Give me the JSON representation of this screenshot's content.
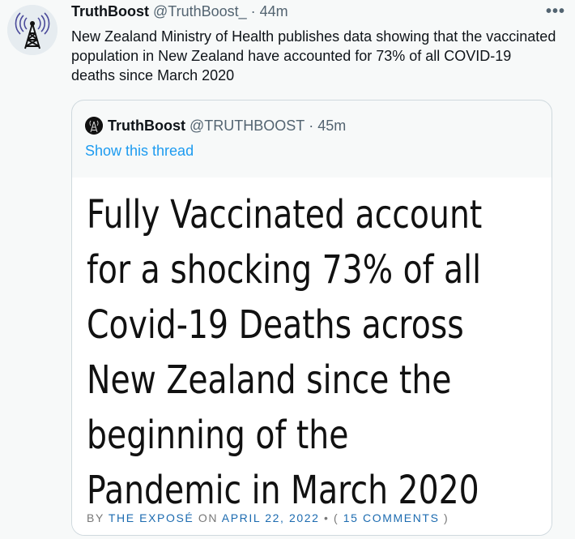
{
  "tweet": {
    "author_name": "TruthBoost",
    "author_handle": "@TruthBoost_",
    "separator": "·",
    "time": "44m",
    "more_label": "•••",
    "text": "New Zealand Ministry of Health publishes data showing that the vaccinated population in New Zealand have accounted for 73% of all COVID-19 deaths since March 2020"
  },
  "quote": {
    "author_name": "TruthBoost",
    "author_handle": "@TRUTHBOOST",
    "separator": "·",
    "time": "45m",
    "thread_link": "Show this thread",
    "headline_lines": [
      "Fully Vaccinated account",
      "for a shocking 73% of all",
      "Covid-19 Deaths across",
      "New Zealand since the",
      "beginning of the",
      "Pandemic in March 2020"
    ],
    "byline": {
      "by": "BY",
      "source": "THE EXPOSÉ",
      "on": "ON",
      "date": "APRIL 22, 2022",
      "bullet": "•",
      "open_paren": "(",
      "comments": "15 COMMENTS",
      "close_paren": ")"
    }
  },
  "icons": {
    "avatar": "radio-tower-icon",
    "quote_avatar": "radio-tower-icon",
    "more": "more-dots-icon"
  },
  "colors": {
    "link": "#1d9bf0",
    "secondary_text": "#536471",
    "byline_accent": "#1c6bb0"
  }
}
